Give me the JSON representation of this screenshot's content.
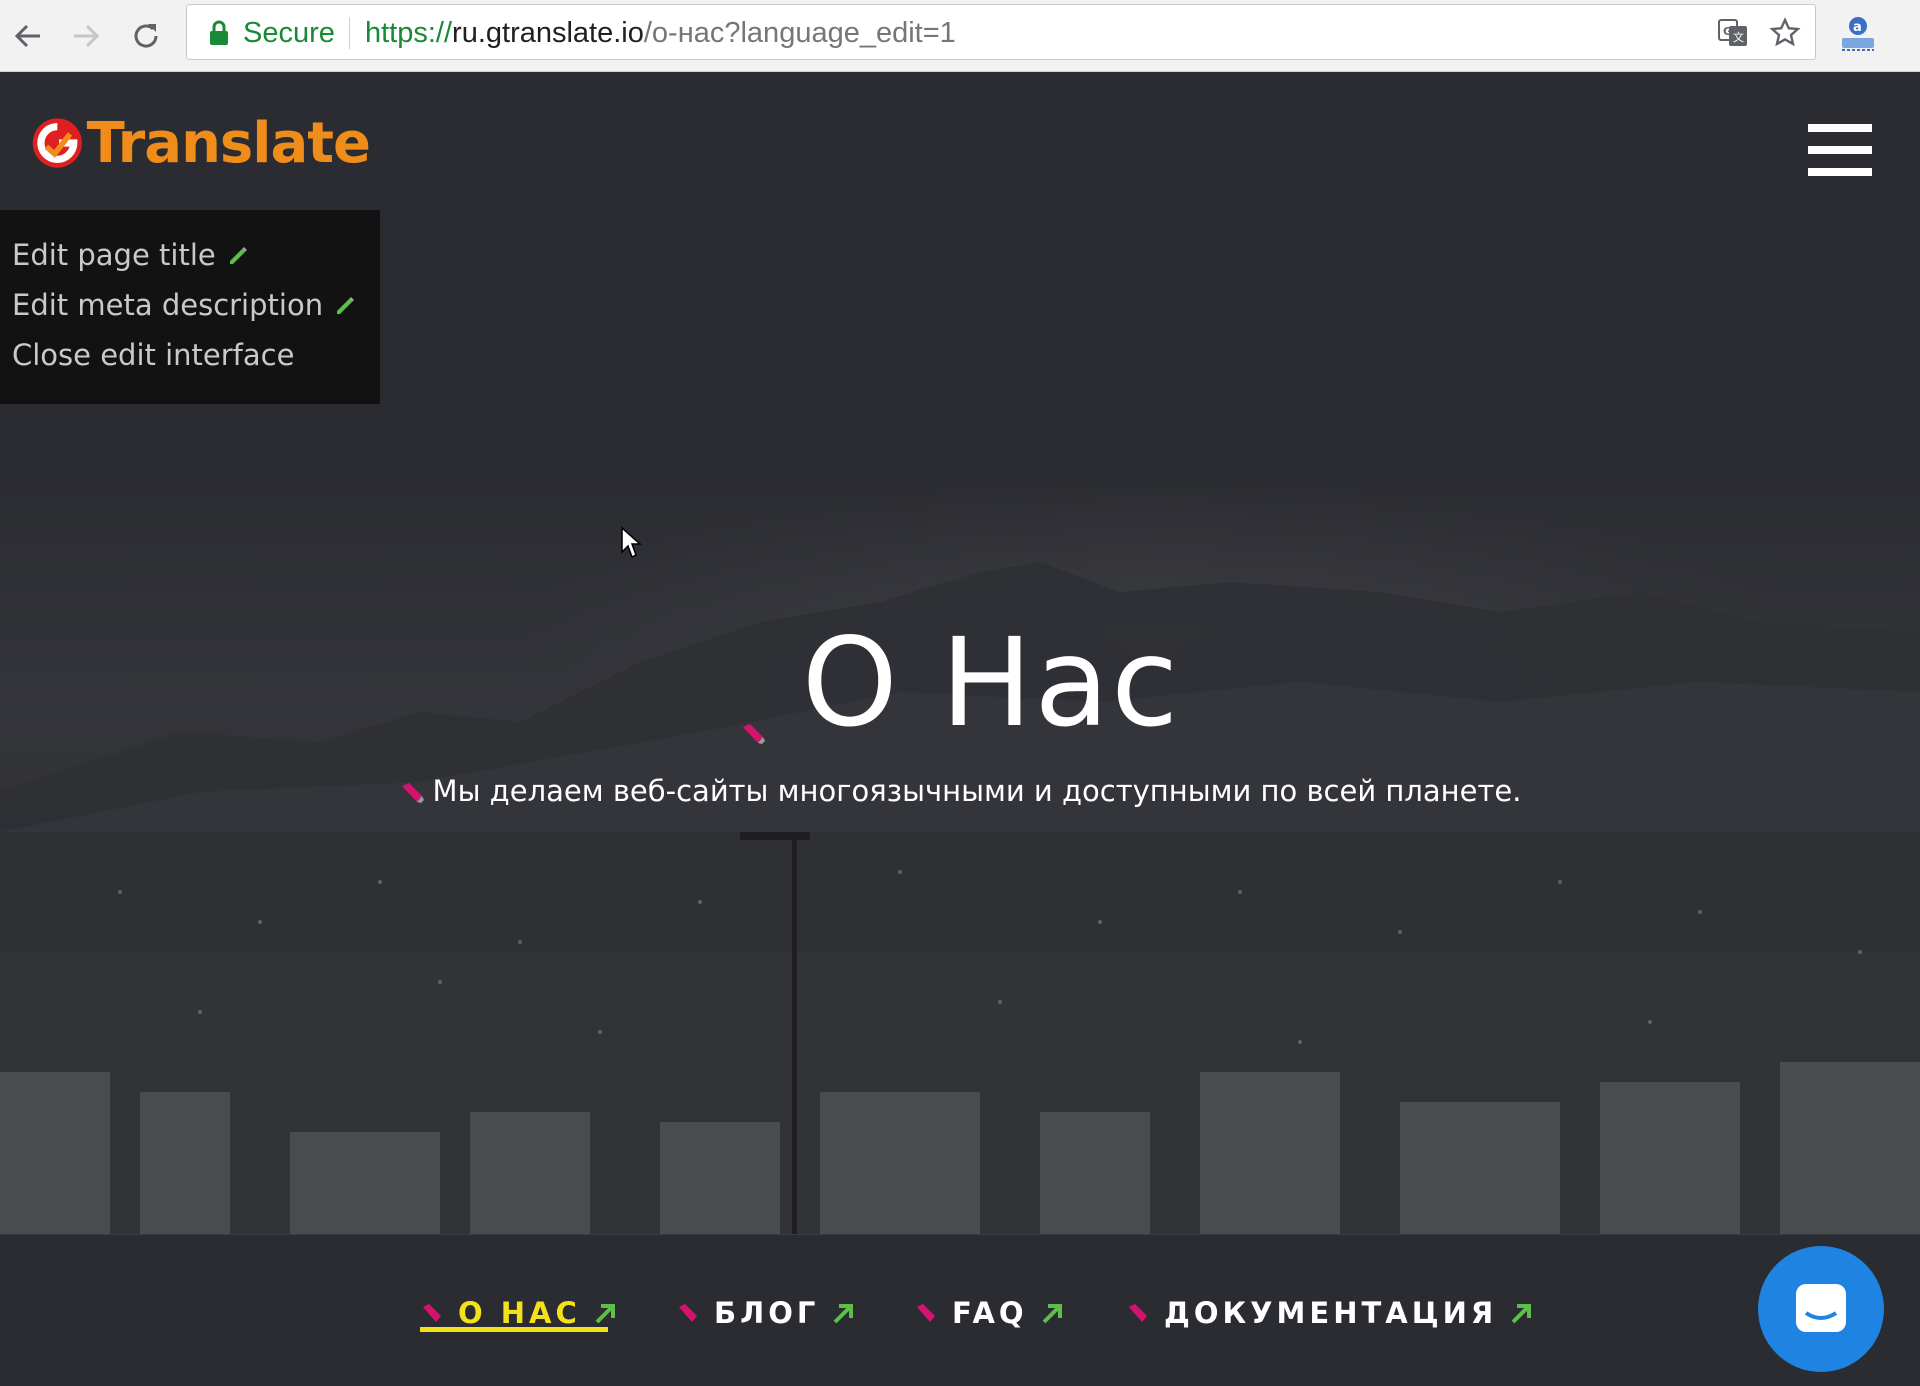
{
  "browser": {
    "secure_label": "Secure",
    "url_scheme": "https://",
    "url_host": "ru.gtranslate.io",
    "url_path": "/о-нас?language_edit=1",
    "icons": [
      "back-arrow-icon",
      "forward-arrow-icon",
      "reload-icon",
      "lock-icon",
      "translate-icon",
      "star-icon",
      "extension-icon"
    ]
  },
  "site": {
    "logo_text": "Translate",
    "accent_color": "#f08c1a"
  },
  "edit_panel": {
    "items": [
      {
        "label": "Edit page title"
      },
      {
        "label": "Edit meta description"
      },
      {
        "label": "Close edit interface"
      }
    ]
  },
  "hero": {
    "title": "О Нас",
    "subtitle": "Мы делаем веб-сайты многоязычными и доступными по всей планете."
  },
  "bottom_nav": {
    "items": [
      {
        "label": "О НАС",
        "active": true
      },
      {
        "label": "БЛОГ",
        "active": false
      },
      {
        "label": "FAQ",
        "active": false
      },
      {
        "label": "ДОКУМЕНТАЦИЯ",
        "active": false
      }
    ],
    "active_color": "#f3e21a"
  },
  "chat": {
    "icon": "chat-bubble-icon",
    "color": "#1f83e2"
  }
}
